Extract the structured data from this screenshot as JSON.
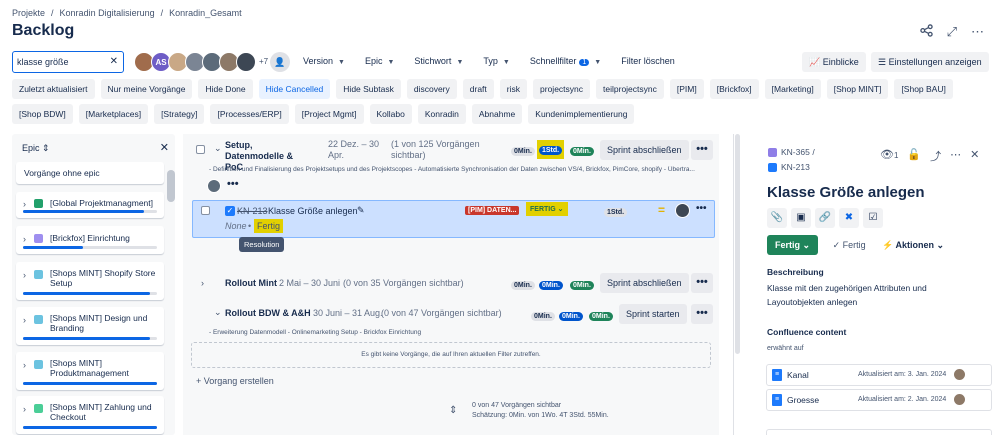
{
  "breadcrumb": [
    "Projekte",
    "/",
    "Konradin Digitalisierung",
    "/",
    "Konradin_Gesamt"
  ],
  "page_title": "Backlog",
  "search": {
    "value": "klasse größe"
  },
  "avatars": {
    "initials": "AS",
    "more": "+7"
  },
  "filters": {
    "version": "Version",
    "epic": "Epic",
    "stichwort": "Stichwort",
    "typ": "Typ",
    "schnellfilter": "Schnellfilter",
    "schnellfilter_count": "1",
    "clear": "Filter löschen"
  },
  "actions": {
    "insights": "Einblicke",
    "settings": "Einstellungen anzeigen"
  },
  "chips_row1": [
    "Zuletzt aktualisiert",
    "Nur meine Vorgänge",
    "Hide Done",
    "Hide Cancelled",
    "Hide Subtask",
    "discovery",
    "draft",
    "risk",
    "projectsync",
    "teilprojectsync",
    "[PIM]",
    "[Brickfox]",
    "[Marketing]",
    "[Shop MINT]",
    "[Shop BAU]"
  ],
  "chips_row2": [
    "[Shop BDW]",
    "[Marketplaces]",
    "[Strategy]",
    "[Processes/ERP]",
    "[Project Mgmt]",
    "Kollabo",
    "Konradin",
    "Abnahme",
    "Kundenimplementierung"
  ],
  "epic_panel": {
    "header": "Epic",
    "no_epic": "Vorgänge ohne epic",
    "epics": [
      {
        "label": "[Global Projektmanagment]",
        "color": "#22a06b",
        "progress": 0.9
      },
      {
        "label": "[Brickfox] Einrichtung",
        "color": "#9f8fef",
        "progress": 0.45
      },
      {
        "label": "[Shops MINT] Shopify Store Setup",
        "color": "#6cc3e0",
        "progress": 0.95
      },
      {
        "label": "[Shops MINT] Design und Branding",
        "color": "#6cc3e0",
        "progress": 0.95
      },
      {
        "label": "[Shops MINT] Produktmanagement",
        "color": "#6cc3e0",
        "progress": 1.0
      },
      {
        "label": "[Shops MINT] Zahlung und Checkout",
        "color": "#4bce97",
        "progress": 1.0
      }
    ]
  },
  "sprint1": {
    "name": "Setup, Datenmodelle & PoC",
    "dates": "22 Dez. – 30 Apr.",
    "count": "(1 von 125 Vorgängen sichtbar)",
    "est": [
      "0Min.",
      "1Std.",
      "0Min."
    ],
    "button": "Sprint abschließen",
    "description": "- Definition und Finalisierung des Projektsetups und des Projektscopes - Automatisierte Synchronisation der Daten zwischen VS/4, Brickfox, PimCore, shopify - Übertra..."
  },
  "issue": {
    "key": "KN-213",
    "summary": "Klasse Größe anlegen",
    "epic_tag": "[PIM] DATEN...",
    "status": "FERTIG",
    "estimate": "1Std.",
    "resolution_none": "None",
    "resolution_value": "Fertig",
    "tooltip": "Resolution"
  },
  "sprint2": {
    "name": "Rollout Mint",
    "dates": "2 Mai – 30 Juni",
    "count": "(0 von 35 Vorgängen sichtbar)",
    "est": [
      "0Min.",
      "0Min.",
      "0Min."
    ],
    "button": "Sprint abschließen"
  },
  "sprint3": {
    "name": "Rollout BDW & A&H",
    "dates": "30 Juni – 31 Aug.",
    "count": "(0 von 47 Vorgängen sichtbar)",
    "est": [
      "0Min.",
      "0Min.",
      "0Min."
    ],
    "button": "Sprint starten",
    "description": "- Erweiterung Datenmodell - Onlinemarketing Setup - Brickfox Einrichtung",
    "empty": "Es gibt keine Vorgänge, die auf Ihren aktuellen Filter zutreffen.",
    "create": "+ Vorgang erstellen",
    "summary_line1": "0 von 47 Vorgängen sichtbar",
    "summary_line2": "Schätzung: 0Min. von 1Wo. 4T 3Std. 55Min."
  },
  "detail": {
    "parent_key": "KN-365",
    "key": "KN-213",
    "watchers": "1",
    "title": "Klasse Größe anlegen",
    "status_button": "Fertig",
    "resolution": "Fertig",
    "actions_label": "Aktionen",
    "description_label": "Beschreibung",
    "description": "Klasse mit den zugehörigen Attributen und Layoutobjekten anlegen",
    "confluence_label": "Confluence content",
    "mentioned": "erwähnt auf",
    "pages": [
      {
        "title": "Kanal",
        "updated": "Aktualisiert am: 3. Jan. 2024"
      },
      {
        "title": "Groesse",
        "updated": "Aktualisiert am: 2. Jan. 2024"
      }
    ]
  }
}
